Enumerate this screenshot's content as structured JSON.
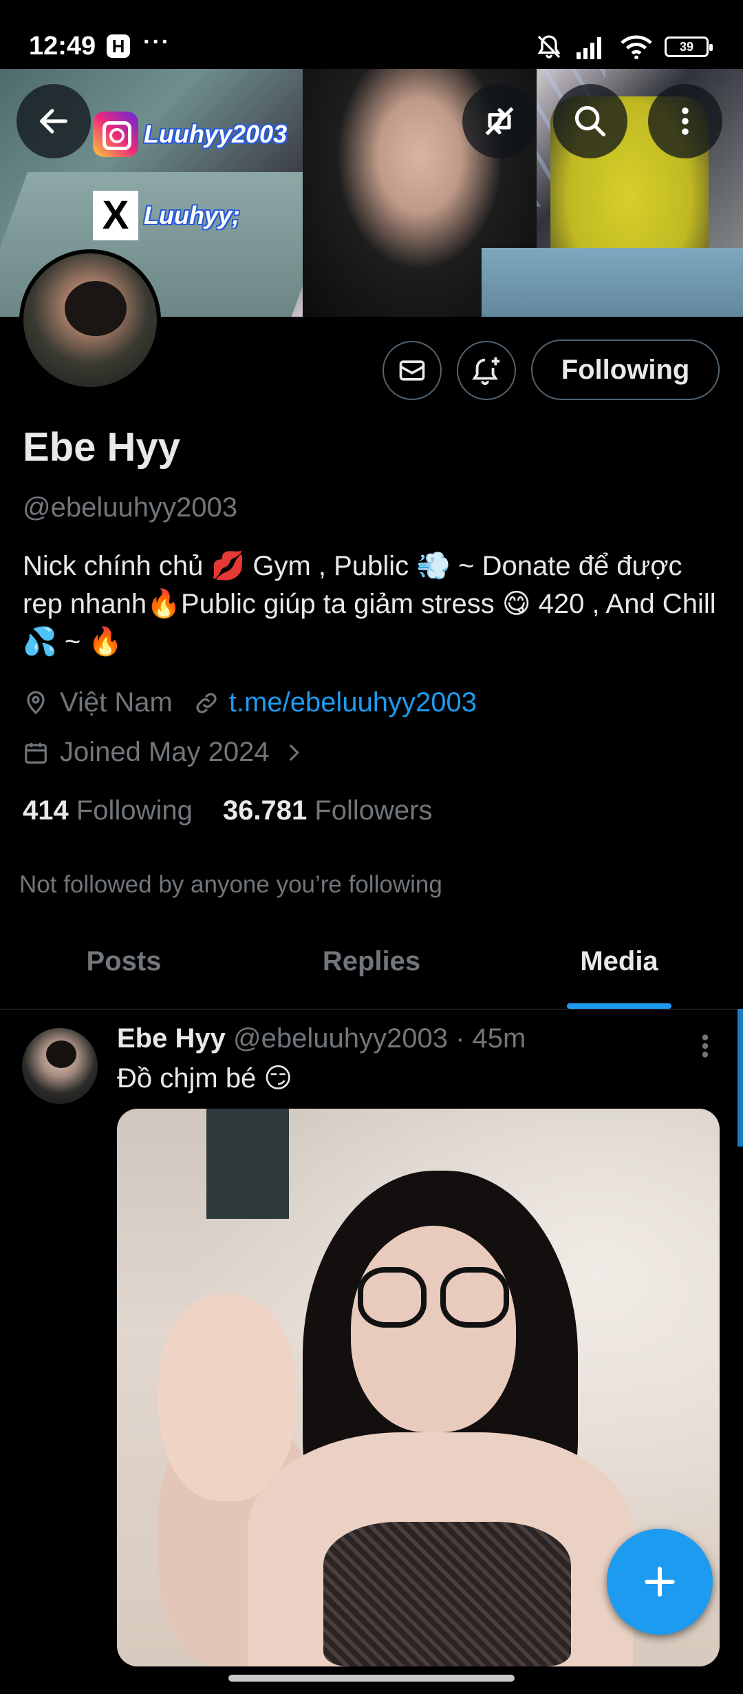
{
  "status_bar": {
    "time": "12:49",
    "app_badge": "H",
    "more": "···",
    "battery": "39"
  },
  "banner": {
    "instagram_handle": "Luuhyy2003",
    "x_handle": "Luuhyy;"
  },
  "profile": {
    "name": "Ebe Hyy",
    "handle": "@ebeluuhyy2003",
    "bio": "Nick chính chủ 💋 Gym , Public 💨  ~ Donate để được rep nhanh🔥Public giúp ta giảm stress 😋     420 , And Chill 💦   ~ 🔥",
    "location": "Việt Nam",
    "website": "t.me/ebeluuhyy2003",
    "joined": "Joined May 2024",
    "following_count": "414",
    "following_label": "Following",
    "followers_count": "36.781",
    "followers_label": "Followers",
    "not_followed_text": "Not followed by anyone you’re following",
    "follow_button_label": "Following"
  },
  "tabs": [
    {
      "label": "Posts"
    },
    {
      "label": "Replies"
    },
    {
      "label": "Media"
    }
  ],
  "active_tab": "Media",
  "post": {
    "author_name": "Ebe Hyy",
    "author_handle": "@ebeluuhyy2003",
    "separator": "·",
    "time": "45m",
    "text": "Đồ chjm bé 😏"
  },
  "colors": {
    "accent": "#1d9bf0",
    "background": "#000000",
    "secondary_text": "#71767b",
    "primary_text": "#e7e9ea"
  },
  "icons": [
    "back-arrow-icon",
    "no-repost-icon",
    "search-icon",
    "more-vertical-icon",
    "mail-icon",
    "bell-plus-icon",
    "location-pin-icon",
    "link-icon",
    "calendar-icon",
    "chevron-right-icon",
    "plus-icon"
  ]
}
